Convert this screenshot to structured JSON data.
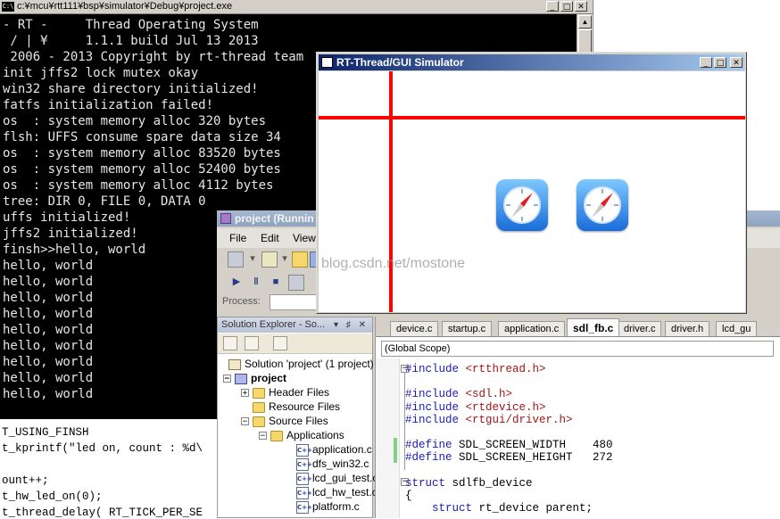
{
  "console": {
    "title": "c:¥mcu¥rtt111¥bsp¥simulator¥Debug¥project.exe",
    "lines": [
      "- RT -     Thread Operating System",
      " / | ¥     1.1.1 build Jul 13 2013",
      " 2006 - 2013 Copyright by rt-thread team",
      "init jffs2 lock mutex okay",
      "win32 share directory initialized!",
      "fatfs initialization failed!",
      "os  : system memory alloc 320 bytes",
      "flsh: UFFS consume spare data size 34",
      "os  : system memory alloc 83520 bytes",
      "os  : system memory alloc 52400 bytes",
      "os  : system memory alloc 4112 bytes",
      "tree: DIR 0, FILE 0, DATA 0",
      "uffs initialized!",
      "jffs2 initialized!",
      "finsh>>hello, world",
      "hello, world",
      "hello, world",
      "hello, world",
      "hello, world",
      "hello, world",
      "hello, world",
      "hello, world",
      "hello, world",
      "hello, world"
    ]
  },
  "background_code": {
    "lines": [
      "T_USING_FINSH",
      "t_kprintf(\"led on, count : %d\\",
      "",
      "ount++;",
      "t_hw_led_on(0);",
      "t_thread_delay( RT_TICK_PER_SE"
    ]
  },
  "simulator": {
    "title": "RT-Thread/GUI Simulator",
    "icons": [
      "compass-app-icon",
      "compass-app-icon"
    ],
    "line_color": "#ff0000"
  },
  "vs": {
    "title": "project (Runnin",
    "menu": [
      "File",
      "Edit",
      "View"
    ],
    "process_label": "Process:"
  },
  "solution_explorer": {
    "header": "Solution Explorer - So...",
    "controls": "▾ ♯ ✕",
    "tree": [
      {
        "label": "Solution 'project' (1 project)",
        "type": "solution"
      },
      {
        "label": "project",
        "type": "project"
      },
      {
        "label": "Header Files",
        "type": "folder"
      },
      {
        "label": "Resource Files",
        "type": "folder"
      },
      {
        "label": "Source Files",
        "type": "folder"
      },
      {
        "label": "Applications",
        "type": "folder"
      },
      {
        "label": "application.c",
        "type": "file"
      },
      {
        "label": "dfs_win32.c",
        "type": "file"
      },
      {
        "label": "lcd_gui_test.c",
        "type": "file"
      },
      {
        "label": "lcd_hw_test.c",
        "type": "file"
      },
      {
        "label": "platform.c",
        "type": "file"
      }
    ]
  },
  "editor": {
    "tabs": [
      "device.c",
      "startup.c",
      "application.c",
      "sdl_fb.c",
      "driver.c",
      "driver.h",
      "lcd_gu"
    ],
    "active_tab": "sdl_fb.c",
    "scope": "(Global Scope)",
    "code": [
      {
        "kw": "#include",
        "rest": " <rtthread.h>",
        "rest_class": "str"
      },
      {
        "kw": "",
        "rest": "",
        "rest_class": ""
      },
      {
        "kw": "#include",
        "rest": " <sdl.h>",
        "rest_class": "str"
      },
      {
        "kw": "#include",
        "rest": " <rtdevice.h>",
        "rest_class": "str"
      },
      {
        "kw": "#include",
        "rest": " <rtgui/driver.h>",
        "rest_class": "str"
      },
      {
        "kw": "",
        "rest": "",
        "rest_class": ""
      },
      {
        "kw": "#define",
        "rest": " SDL_SCREEN_WIDTH    480",
        "rest_class": ""
      },
      {
        "kw": "#define",
        "rest": " SDL_SCREEN_HEIGHT   272",
        "rest_class": ""
      },
      {
        "kw": "",
        "rest": "",
        "rest_class": ""
      },
      {
        "kw": "struct",
        "rest": " sdlfb_device",
        "rest_class": ""
      },
      {
        "kw": "",
        "rest": "{",
        "rest_class": ""
      },
      {
        "kw": "    struct",
        "rest": " rt_device parent;",
        "rest_class": ""
      }
    ]
  },
  "watermark": "blog.csdn.net/mostone",
  "window_buttons": {
    "minimize": "_",
    "maximize": "□",
    "close": "✕"
  }
}
